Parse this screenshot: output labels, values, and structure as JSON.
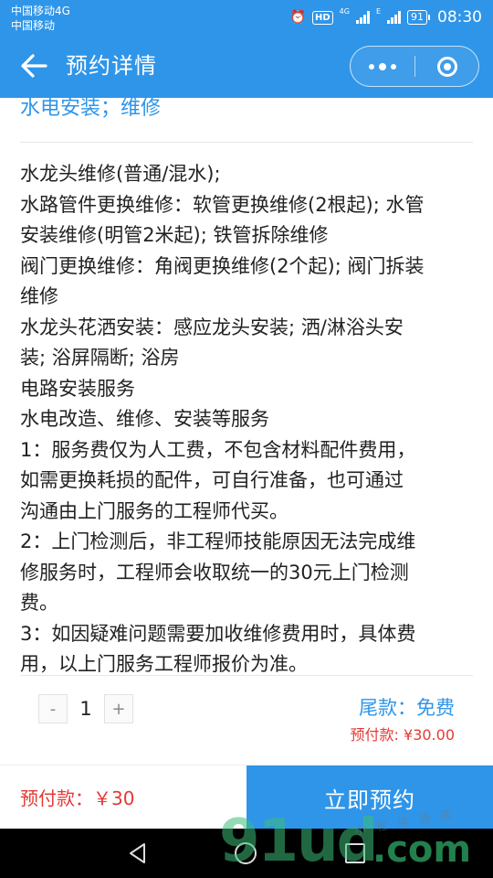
{
  "status_bar": {
    "carrier_line1": "中国移动4G",
    "carrier_line2": "中国移动",
    "hd": "HD",
    "net1": "4G",
    "net2": "E",
    "battery": "91",
    "time": "08:30"
  },
  "nav": {
    "title": "预约详情"
  },
  "service": {
    "category": "水电安装；维修",
    "description_lines": [
      "水龙头维修(普通/混水);",
      "水路管件更换维修：软管更换维修(2根起); 水管",
      "安装维修(明管2米起); 铁管拆除维修",
      "阀门更换维修：角阀更换维修(2个起); 阀门拆装",
      "维修",
      "水龙头花洒安装：感应龙头安装; 洒/淋浴头安",
      "装; 浴屏隔断; 浴房",
      "电路安装服务",
      "水电改造、维修、安装等服务",
      "1：服务费仅为人工费，不包含材料配件费用，",
      "如需更换耗损的配件，可自行准备，也可通过",
      "沟通由上门服务的工程师代买。",
      "2：上门检测后，非工程师技能原因无法完成维",
      "修服务时，工程师会收取统一的30元上门检测",
      "费。",
      "3：如因疑难问题需要加收维修费用时，具体费",
      "用，以上门服务工程师报价为准。"
    ]
  },
  "order": {
    "minus": "-",
    "quantity": "1",
    "plus": "+",
    "balance_label": "尾款：免费",
    "prepay_label": "预付款: ¥30.00"
  },
  "bottom_bar": {
    "prepay": "预付款：￥30",
    "book_now": "立即预约"
  },
  "watermark": {
    "main": "91ud",
    "domain": ".com",
    "small": "小 程 序 商 店"
  },
  "colors": {
    "accent": "#2f95e8",
    "price": "#e53935"
  }
}
